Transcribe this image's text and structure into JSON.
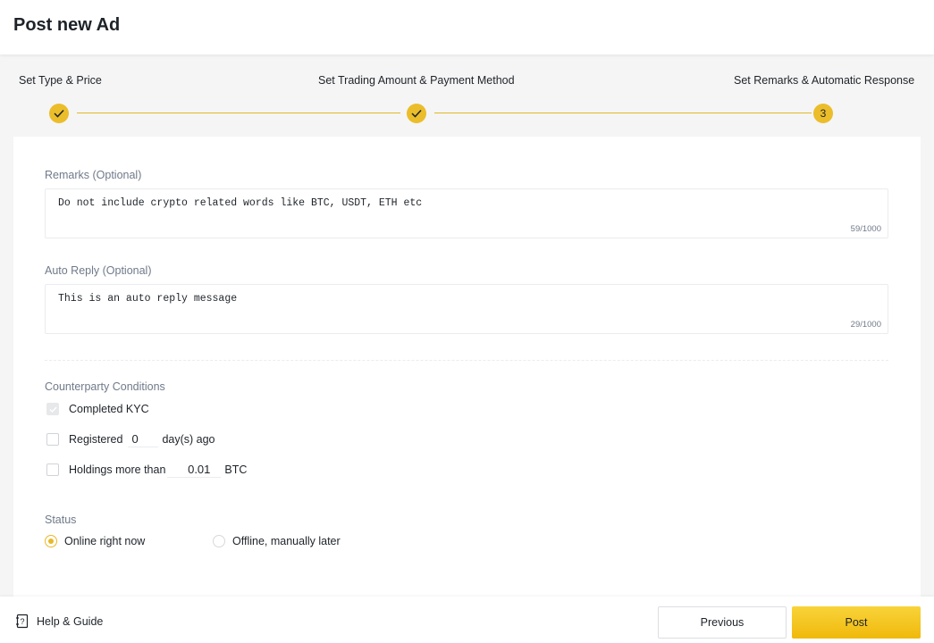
{
  "header": {
    "title": "Post new Ad"
  },
  "steps": [
    {
      "label": "Set Type & Price",
      "status": "done"
    },
    {
      "label": "Set Trading Amount & Payment Method",
      "status": "done"
    },
    {
      "label": "Set Remarks & Automatic Response",
      "status": "current",
      "number": "3"
    }
  ],
  "remarks": {
    "label": "Remarks (Optional)",
    "value": "Do not include crypto related words like BTC, USDT, ETH etc",
    "counter": "59/1000"
  },
  "auto_reply": {
    "label": "Auto Reply (Optional)",
    "value": "This is an auto reply message",
    "counter": "29/1000"
  },
  "counterparty": {
    "label": "Counterparty Conditions",
    "kyc_label": "Completed KYC",
    "registered_label": "Registered",
    "registered_value": "0",
    "registered_suffix": "day(s) ago",
    "holdings_label": "Holdings more than",
    "holdings_value": "0.01",
    "holdings_suffix": "BTC"
  },
  "status": {
    "label": "Status",
    "options": [
      "Online right now",
      "Offline, manually later"
    ],
    "selected": "Online right now"
  },
  "footer": {
    "help_label": "Help & Guide",
    "previous_label": "Previous",
    "post_label": "Post"
  },
  "colors": {
    "accent": "#ebbd2a",
    "post_button": "#f0b90b"
  }
}
